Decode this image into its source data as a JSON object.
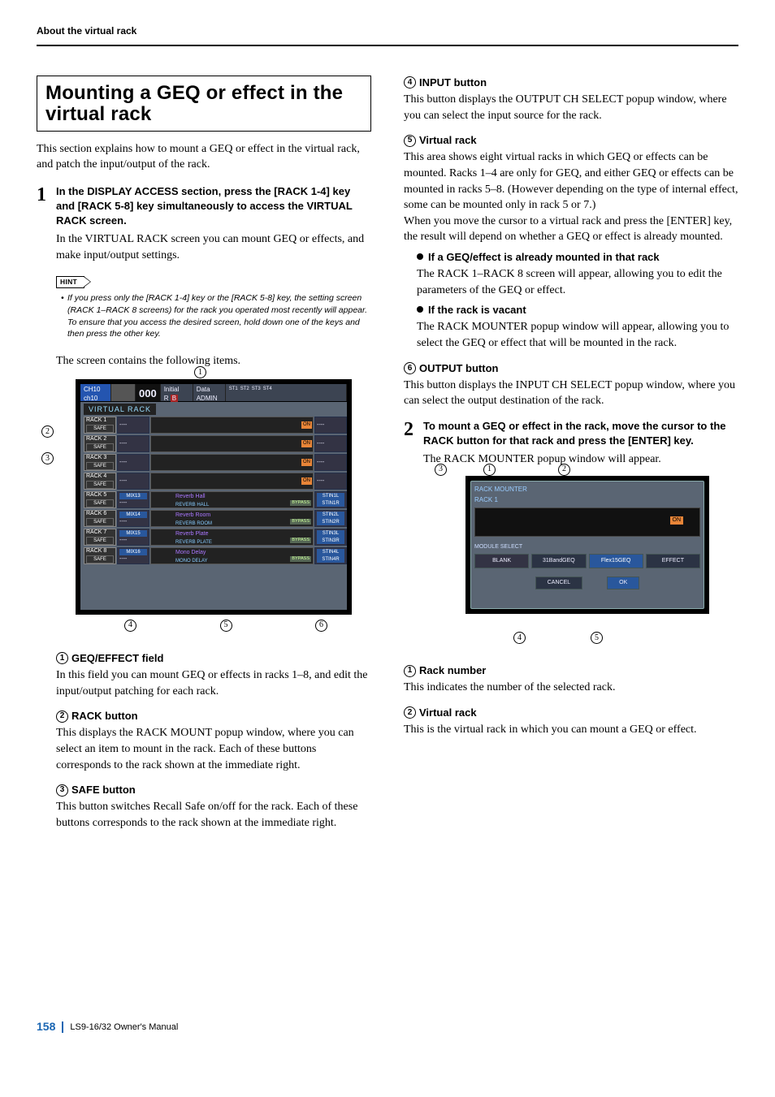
{
  "header": {
    "section_title": "About the virtual rack"
  },
  "footer": {
    "page_number": "158",
    "manual_title": "LS9-16/32  Owner's Manual"
  },
  "main_heading": "Mounting a GEQ or effect in the virtual rack",
  "intro_text": "This section explains how to mount a GEQ or effect in the virtual rack, and patch the input/output of the rack.",
  "step1": {
    "num": "1",
    "title": "In the DISPLAY ACCESS section, press the [RACK 1-4] key and [RACK 5-8] key simultaneously to access the VIRTUAL RACK screen.",
    "desc": "In the VIRTUAL RACK screen you can mount GEQ or effects, and make input/output settings."
  },
  "hint": {
    "label": "HINT",
    "text": "If you press only the [RACK 1-4] key or the [RACK 5-8] key, the setting screen (RACK 1–RACK 8 screens) for the rack you operated most recently will appear. To ensure that you access the desired screen, hold down one of the keys and then press the other key."
  },
  "items_intro": "The screen contains the following items.",
  "screenshot1": {
    "top": {
      "ch_upper": "CH10",
      "ch_lower": "ch10",
      "scene_num": "000",
      "scene_name_upper": "Initial",
      "scene_name_lower": "R",
      "scene_badge": "B",
      "user_label": "Data",
      "user_value": "ADMIN",
      "st_labels": [
        "ST1",
        "ST2",
        "ST3",
        "ST4"
      ]
    },
    "tab_label": "VIRTUAL RACK",
    "racks": [
      {
        "name": "RACK 1",
        "safe": "SAFE",
        "in": "----",
        "effect": "",
        "on": "ON",
        "out": "----"
      },
      {
        "name": "RACK 2",
        "safe": "SAFE",
        "in": "----",
        "effect": "",
        "on": "ON",
        "out": "----"
      },
      {
        "name": "RACK 3",
        "safe": "SAFE",
        "in": "----",
        "effect": "",
        "on": "ON",
        "out": "----"
      },
      {
        "name": "RACK 4",
        "safe": "SAFE",
        "in": "----",
        "effect": "",
        "on": "ON",
        "out": "----"
      },
      {
        "name": "RACK 5",
        "safe": "SAFE",
        "in_upper": "MIX13",
        "in_lower": "----",
        "effect_upper": "Reverb Hall",
        "effect_lower": "REVERB HALL",
        "bypass": "BYPASS",
        "out_upper": "STIN1L",
        "out_lower": "STIN1R"
      },
      {
        "name": "RACK 6",
        "safe": "SAFE",
        "in_upper": "MIX14",
        "in_lower": "----",
        "effect_upper": "Reverb Room",
        "effect_lower": "REVERB ROOM",
        "bypass": "BYPASS",
        "out_upper": "STIN2L",
        "out_lower": "STIN2R"
      },
      {
        "name": "RACK 7",
        "safe": "SAFE",
        "in_upper": "MIX15",
        "in_lower": "----",
        "effect_upper": "Reverb Plate",
        "effect_lower": "REVERB PLATE",
        "bypass": "BYPASS",
        "out_upper": "STIN3L",
        "out_lower": "STIN3R"
      },
      {
        "name": "RACK 8",
        "safe": "SAFE",
        "in_upper": "MIX16",
        "in_lower": "----",
        "effect_upper": "Mono Delay",
        "effect_lower": "MONO DELAY",
        "bypass": "BYPASS",
        "out_upper": "STIN4L",
        "out_lower": "STIN4R"
      }
    ],
    "callouts": {
      "c1": "1",
      "c2": "2",
      "c3": "3",
      "c4": "4",
      "c5": "5",
      "c6": "6"
    }
  },
  "items_left": [
    {
      "num": "1",
      "title": "GEQ/EFFECT field",
      "body": "In this field you can mount GEQ or effects in racks 1–8, and edit the input/output patching for each rack."
    },
    {
      "num": "2",
      "title": "RACK button",
      "body": "This displays the RACK MOUNT popup window, where you can select an item to mount in the rack. Each of these buttons corresponds to the rack shown at the immediate right."
    },
    {
      "num": "3",
      "title": "SAFE button",
      "body": "This button switches Recall Safe on/off for the rack. Each of these buttons corresponds to the rack shown at the immediate right."
    }
  ],
  "items_right_top": [
    {
      "num": "4",
      "title": "INPUT button",
      "body": "This button displays the OUTPUT CH SELECT popup window, where you can select the input source for the rack."
    },
    {
      "num": "5",
      "title": "Virtual rack",
      "body": "This area shows eight virtual racks in which GEQ or effects can be mounted. Racks 1–4 are only for GEQ, and either GEQ or effects can be mounted in racks 5–8. (However depending on the type of internal effect, some can be mounted only in rack 5 or 7.)\nWhen you move the cursor to a virtual rack and press the [ENTER] key, the result will depend on whether a GEQ or effect is already mounted.",
      "bullets": [
        {
          "title": "If a GEQ/effect is already mounted in that rack",
          "body": "The RACK 1–RACK 8 screen will appear, allowing you to edit the parameters of the GEQ or effect."
        },
        {
          "title": "If the rack is vacant",
          "body": "The RACK MOUNTER popup window will appear, allowing you to select the GEQ or effect that will be mounted in the rack."
        }
      ]
    },
    {
      "num": "6",
      "title": "OUTPUT button",
      "body": "This button displays the INPUT CH SELECT popup window, where you can select the output destination of the rack."
    }
  ],
  "step2": {
    "num": "2",
    "title": "To mount a GEQ or effect in the rack, move the cursor to the RACK button for that rack and press the [ENTER] key.",
    "desc": "The RACK MOUNTER popup window will appear."
  },
  "screenshot2": {
    "title_line1": "RACK MOUNTER",
    "title_line2": "RACK 1",
    "on": "ON",
    "module_select_label": "MODULE SELECT",
    "buttons": [
      "BLANK",
      "31BandGEQ",
      "Flex15GEQ",
      "EFFECT"
    ],
    "cancel": "CANCEL",
    "ok": "OK",
    "callouts": {
      "c1": "1",
      "c2": "2",
      "c3": "3",
      "c4": "4",
      "c5": "5"
    }
  },
  "items_right_bottom": [
    {
      "num": "1",
      "title": "Rack number",
      "body": "This indicates the number of the selected rack."
    },
    {
      "num": "2",
      "title": "Virtual rack",
      "body": "This is the virtual rack in which you can mount a GEQ or effect."
    }
  ]
}
